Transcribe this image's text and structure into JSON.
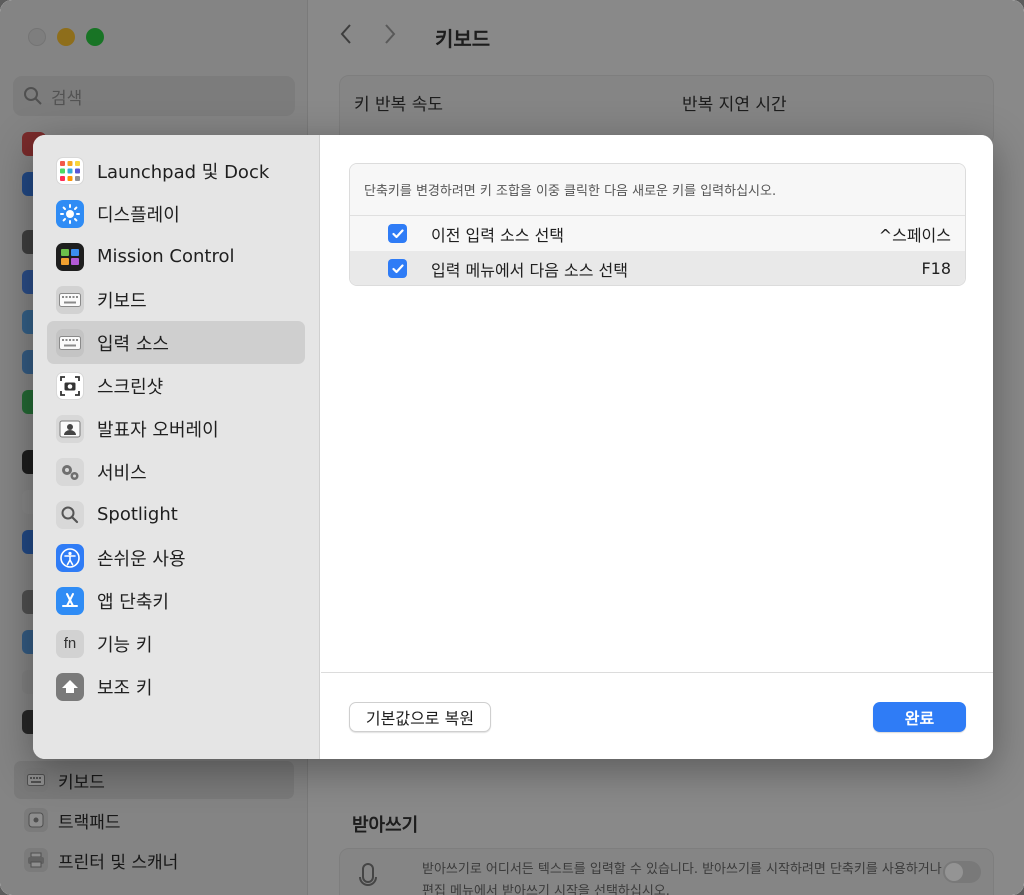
{
  "background": {
    "search_placeholder": "검색",
    "window_title": "키보드",
    "key_repeat_label": "키 반복 속도",
    "repeat_delay_label": "반복 지연 시간",
    "sidebar_bottom": [
      {
        "label": "키보드",
        "icon": "keyboard-icon"
      },
      {
        "label": "트랙패드",
        "icon": "trackpad-icon"
      },
      {
        "label": "프린터 및 스캐너",
        "icon": "printer-icon"
      }
    ],
    "dictation_section": "받아쓰기",
    "dictation_text_line1": "받아쓰기로 어디서든 텍스트를 입력할 수 있습니다. 받아쓰기를 시작하려면 단축키를 사용하거나",
    "dictation_text_line2": "편집 메뉴에서 받아쓰기 시작을 선택하십시오."
  },
  "sheet": {
    "sidebar": {
      "items": [
        {
          "label": "Launchpad 및 Dock",
          "icon": "launchpad-icon",
          "selected": false
        },
        {
          "label": "디스플레이",
          "icon": "display-icon",
          "selected": false
        },
        {
          "label": "Mission Control",
          "icon": "mission-control-icon",
          "selected": false
        },
        {
          "label": "키보드",
          "icon": "keyboard-icon",
          "selected": false
        },
        {
          "label": "입력 소스",
          "icon": "input-sources-icon",
          "selected": true
        },
        {
          "label": "스크린샷",
          "icon": "screenshot-icon",
          "selected": false
        },
        {
          "label": "발표자 오버레이",
          "icon": "presenter-overlay-icon",
          "selected": false
        },
        {
          "label": "서비스",
          "icon": "services-icon",
          "selected": false
        },
        {
          "label": "Spotlight",
          "icon": "spotlight-icon",
          "selected": false
        },
        {
          "label": "손쉬운 사용",
          "icon": "accessibility-icon",
          "selected": false
        },
        {
          "label": "앱 단축키",
          "icon": "app-shortcuts-icon",
          "selected": false
        },
        {
          "label": "기능 키",
          "icon": "function-keys-icon",
          "selected": false
        },
        {
          "label": "보조 키",
          "icon": "modifier-keys-icon",
          "selected": false
        }
      ]
    },
    "description": "단축키를 변경하려면 키 조합을 이중 클릭한 다음 새로운 키를 입력하십시오.",
    "shortcuts": [
      {
        "name": "이전 입력 소스 선택",
        "key": "^스페이스",
        "checked": true
      },
      {
        "name": "입력 메뉴에서 다음 소스 선택",
        "key": "F18",
        "checked": true
      }
    ],
    "restore_button": "기본값으로 복원",
    "done_button": "완료"
  },
  "colors": {
    "accent": "#2f7cf6",
    "selected_row": "#cfcfcf"
  }
}
